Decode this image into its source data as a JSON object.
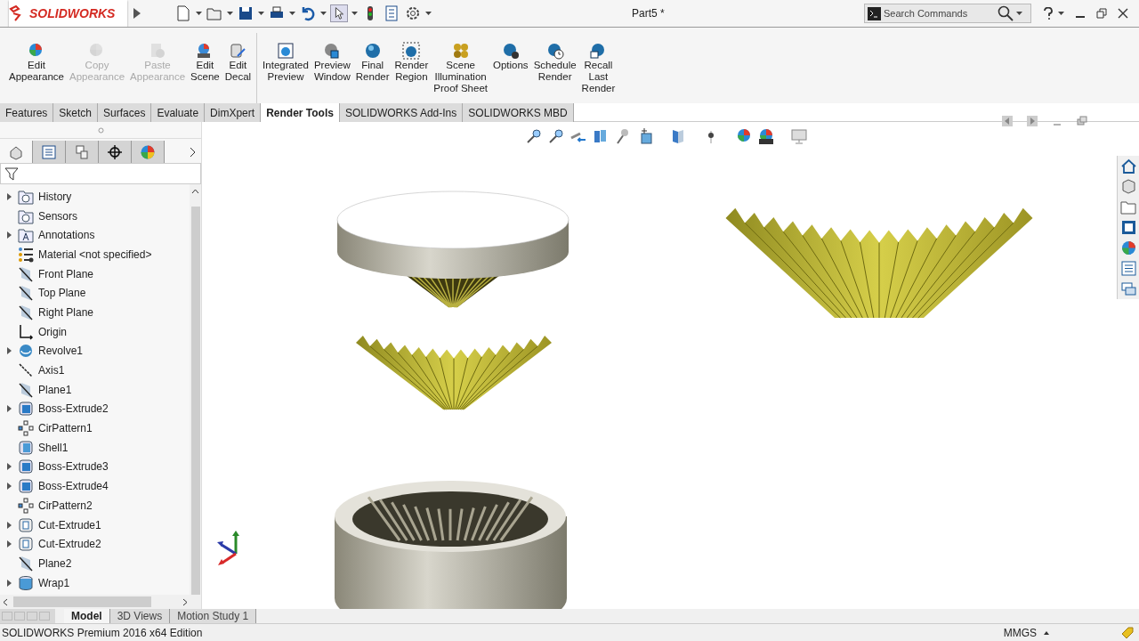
{
  "app": {
    "logo": "SOLIDWORKS",
    "document_title": "Part5 *",
    "search": {
      "placeholder": "Search Commands"
    }
  },
  "ribbon": [
    {
      "label": "Edit\nAppearance",
      "kind": "appearance",
      "disabled": false
    },
    {
      "label": "Copy\nAppearance",
      "kind": "appearance",
      "disabled": true
    },
    {
      "label": "Paste\nAppearance",
      "kind": "paste",
      "disabled": true
    },
    {
      "label": "Edit\nScene",
      "kind": "scene",
      "disabled": false
    },
    {
      "label": "Edit\nDecal",
      "kind": "decal",
      "disabled": false
    },
    {
      "label": "Integrated\nPreview",
      "kind": "preview",
      "disabled": false
    },
    {
      "label": "Preview\nWindow",
      "kind": "window",
      "disabled": false
    },
    {
      "label": "Final\nRender",
      "kind": "sphere",
      "disabled": false
    },
    {
      "label": "Render\nRegion",
      "kind": "region",
      "disabled": false
    },
    {
      "label": "Scene\nIllumination\nProof Sheet",
      "kind": "proof",
      "disabled": false
    },
    {
      "label": "Options",
      "kind": "options",
      "disabled": false
    },
    {
      "label": "Schedule\nRender",
      "kind": "schedule",
      "disabled": false
    },
    {
      "label": "Recall\nLast\nRender",
      "kind": "recall",
      "disabled": false
    }
  ],
  "tabs": [
    {
      "label": "Features",
      "selected": false
    },
    {
      "label": "Sketch",
      "selected": false
    },
    {
      "label": "Surfaces",
      "selected": false
    },
    {
      "label": "Evaluate",
      "selected": false
    },
    {
      "label": "DimXpert",
      "selected": false
    },
    {
      "label": "Render Tools",
      "selected": true
    },
    {
      "label": "SOLIDWORKS Add-Ins",
      "selected": false
    },
    {
      "label": "SOLIDWORKS MBD",
      "selected": false
    }
  ],
  "panel_tabs": [
    {
      "selected": true
    },
    {
      "selected": false
    },
    {
      "selected": false
    },
    {
      "selected": false
    },
    {
      "selected": false
    }
  ],
  "tree": [
    {
      "label": "History",
      "kind": "folder",
      "expandable": true
    },
    {
      "label": "Sensors",
      "kind": "folder",
      "expandable": false
    },
    {
      "label": "Annotations",
      "kind": "annotation",
      "expandable": true
    },
    {
      "label": "Material <not specified>",
      "kind": "material",
      "expandable": false
    },
    {
      "label": "Front Plane",
      "kind": "plane",
      "expandable": false
    },
    {
      "label": "Top Plane",
      "kind": "plane",
      "expandable": false
    },
    {
      "label": "Right Plane",
      "kind": "plane",
      "expandable": false
    },
    {
      "label": "Origin",
      "kind": "origin",
      "expandable": false
    },
    {
      "label": "Revolve1",
      "kind": "revolve",
      "expandable": true
    },
    {
      "label": "Axis1",
      "kind": "axis",
      "expandable": false
    },
    {
      "label": "Plane1",
      "kind": "plane",
      "expandable": false
    },
    {
      "label": "Boss-Extrude2",
      "kind": "boss",
      "expandable": true
    },
    {
      "label": "CirPattern1",
      "kind": "pattern",
      "expandable": false
    },
    {
      "label": "Shell1",
      "kind": "shell",
      "expandable": false
    },
    {
      "label": "Boss-Extrude3",
      "kind": "boss",
      "expandable": true
    },
    {
      "label": "Boss-Extrude4",
      "kind": "boss",
      "expandable": true
    },
    {
      "label": "CirPattern2",
      "kind": "pattern",
      "expandable": false
    },
    {
      "label": "Cut-Extrude1",
      "kind": "cut",
      "expandable": true
    },
    {
      "label": "Cut-Extrude2",
      "kind": "cut",
      "expandable": true
    },
    {
      "label": "Plane2",
      "kind": "plane",
      "expandable": false
    },
    {
      "label": "Wrap1",
      "kind": "wrap",
      "expandable": true
    }
  ],
  "bottom_tabs": [
    {
      "label": "Model",
      "selected": true
    },
    {
      "label": "3D Views",
      "selected": false
    },
    {
      "label": "Motion Study 1",
      "selected": false
    }
  ],
  "status_bar": {
    "edition": "SOLIDWORKS Premium 2016 x64 Edition",
    "units": "MMGS"
  }
}
